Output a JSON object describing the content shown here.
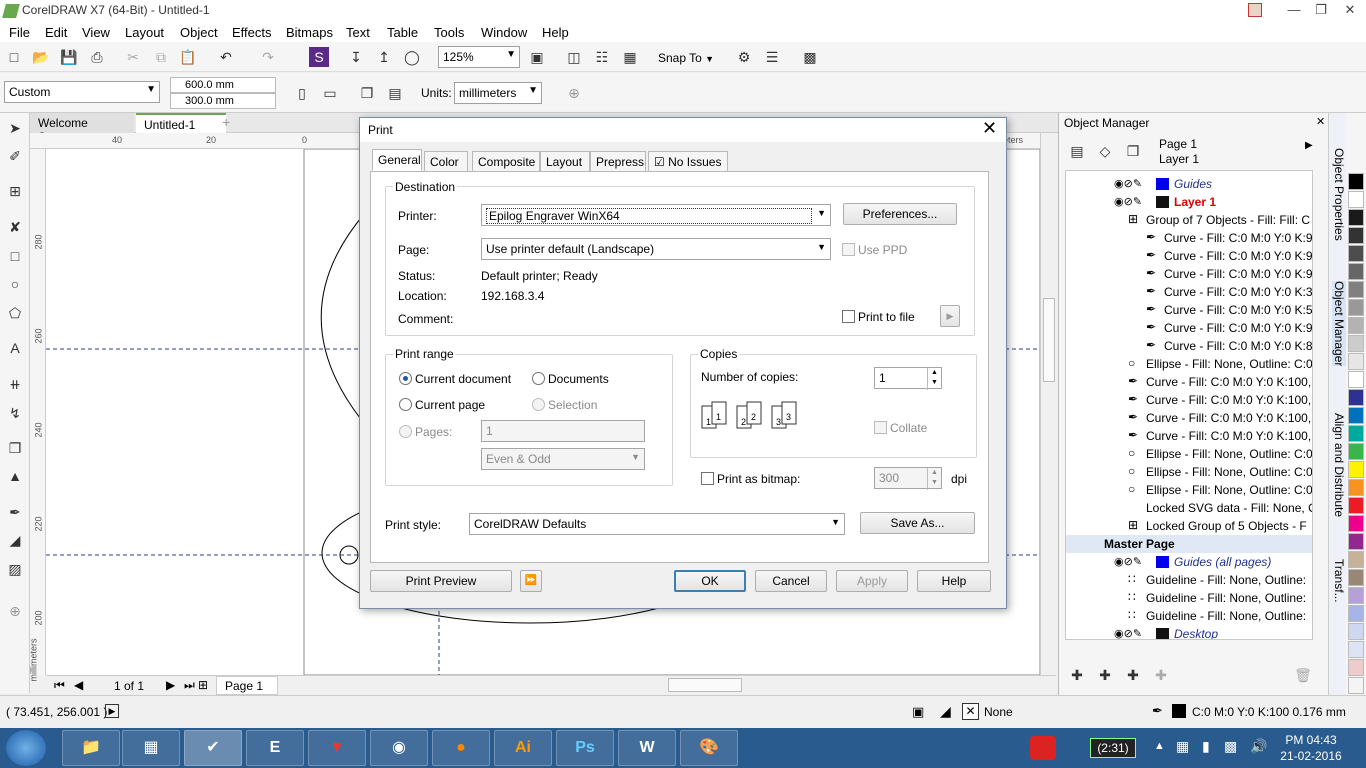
{
  "window": {
    "title": "CorelDRAW X7 (64-Bit) - Untitled-1"
  },
  "menu": [
    "File",
    "Edit",
    "View",
    "Layout",
    "Object",
    "Effects",
    "Bitmaps",
    "Text",
    "Table",
    "Tools",
    "Window",
    "Help"
  ],
  "toolbar": {
    "zoom": "125%",
    "snap_to": "Snap To"
  },
  "propbar": {
    "page_preset": "Custom",
    "width": "600.0 mm",
    "height": "300.0 mm",
    "units_label": "Units:",
    "units": "millimeters"
  },
  "doc_tabs": [
    "Welcome Screen",
    "Untitled-1"
  ],
  "ruler": {
    "top": [
      "40",
      "20",
      "0"
    ],
    "left": [
      "280",
      "260",
      "240",
      "220",
      "200"
    ],
    "unit": "millimeters",
    "unit_right": "millimeters"
  },
  "page_nav": {
    "count": "1 of 1",
    "tab": "Page 1"
  },
  "object_manager": {
    "title": "Object Manager",
    "page": "Page 1",
    "layer": "Layer 1",
    "rows": [
      {
        "indent": 0,
        "text": "Guides",
        "style": "guides"
      },
      {
        "indent": 0,
        "text": "Layer 1",
        "style": "layer"
      },
      {
        "indent": 1,
        "text": "Group of 7 Objects - Fill: Fill: C"
      },
      {
        "indent": 2,
        "text": "Curve - Fill: C:0 M:0 Y:0 K:9"
      },
      {
        "indent": 2,
        "text": "Curve - Fill: C:0 M:0 Y:0 K:9"
      },
      {
        "indent": 2,
        "text": "Curve - Fill: C:0 M:0 Y:0 K:9"
      },
      {
        "indent": 2,
        "text": "Curve - Fill: C:0 M:0 Y:0 K:3"
      },
      {
        "indent": 2,
        "text": "Curve - Fill: C:0 M:0 Y:0 K:5"
      },
      {
        "indent": 2,
        "text": "Curve - Fill: C:0 M:0 Y:0 K:9"
      },
      {
        "indent": 2,
        "text": "Curve - Fill: C:0 M:0 Y:0 K:8"
      },
      {
        "indent": 1,
        "text": "Ellipse - Fill: None, Outline: C:0"
      },
      {
        "indent": 1,
        "text": "Curve - Fill: C:0 M:0 Y:0 K:100,"
      },
      {
        "indent": 1,
        "text": "Curve - Fill: C:0 M:0 Y:0 K:100,"
      },
      {
        "indent": 1,
        "text": "Curve - Fill: C:0 M:0 Y:0 K:100,"
      },
      {
        "indent": 1,
        "text": "Curve - Fill: C:0 M:0 Y:0 K:100,"
      },
      {
        "indent": 1,
        "text": "Ellipse - Fill: None, Outline: C:0"
      },
      {
        "indent": 1,
        "text": "Ellipse - Fill: None, Outline: C:0"
      },
      {
        "indent": 1,
        "text": "Ellipse - Fill: None, Outline: C:0"
      },
      {
        "indent": 1,
        "text": "Locked SVG data - Fill: None, Out"
      },
      {
        "indent": 1,
        "text": "Locked Group of 5 Objects - F"
      },
      {
        "indent": 0,
        "text": "Master Page",
        "style": "master"
      },
      {
        "indent": 0,
        "text": "Guides (all pages)",
        "style": "guides-all"
      },
      {
        "indent": 1,
        "text": "Guideline - Fill: None, Outline:"
      },
      {
        "indent": 1,
        "text": "Guideline - Fill: None, Outline:"
      },
      {
        "indent": 1,
        "text": "Guideline - Fill: None, Outline:"
      },
      {
        "indent": 0,
        "text": "Desktop",
        "style": "desktop"
      }
    ]
  },
  "dockers": [
    "Object Properties",
    "Object Manager",
    "Align and Distribute",
    "Transf..."
  ],
  "palette": [
    "#000000",
    "#ffffff",
    "#1a1a1a",
    "#333333",
    "#4d4d4d",
    "#666666",
    "#808080",
    "#999999",
    "#b3b3b3",
    "#cccccc",
    "#e6e6e6",
    "#ffffff",
    "#2e3192",
    "#0071bc",
    "#00a99d",
    "#39b54a",
    "#fff200",
    "#f7941d",
    "#ed1c24",
    "#ec008c",
    "#92278f",
    "#c7b299",
    "#998675",
    "#b5a0d8",
    "#a7b4e8",
    "#cfd7f0",
    "#dfe3f6",
    "#ecc",
    "#f4f4f4"
  ],
  "status": {
    "coords": "( 73.451, 256.001 )",
    "fill": "None",
    "outline": "C:0 M:0 Y:0 K:100  0.176 mm"
  },
  "taskbar": {
    "apps": [
      "",
      "",
      "",
      "",
      "E",
      "",
      "",
      "",
      "Ai",
      "Ps",
      "W",
      ""
    ],
    "time": "PM 04:43",
    "date": "21-02-2016",
    "battery": "(2:31)"
  },
  "dialog": {
    "title": "Print",
    "tabs": [
      "General",
      "Color",
      "Composite",
      "Layout",
      "Prepress",
      "No Issues"
    ],
    "destination": {
      "label": "Destination",
      "printer_label": "Printer:",
      "printer": "Epilog Engraver WinX64",
      "preferences": "Preferences...",
      "page_label": "Page:",
      "page": "Use printer default (Landscape)",
      "use_ppd": "Use PPD",
      "status_label": "Status:",
      "status": "Default printer; Ready",
      "location_label": "Location:",
      "location": "192.168.3.4",
      "comment_label": "Comment:",
      "print_to_file": "Print to file"
    },
    "print_range": {
      "label": "Print range",
      "current_document": "Current document",
      "documents": "Documents",
      "current_page": "Current page",
      "selection": "Selection",
      "pages_label": "Pages:",
      "pages": "1",
      "even_odd": "Even & Odd"
    },
    "copies": {
      "label": "Copies",
      "number_label": "Number of copies:",
      "number": "1",
      "collate": "Collate",
      "print_as_bitmap": "Print as bitmap:",
      "dpi_value": "300",
      "dpi": "dpi"
    },
    "print_style_label": "Print style:",
    "print_style": "CorelDRAW Defaults",
    "save_as": "Save As...",
    "buttons": {
      "preview": "Print Preview",
      "ok": "OK",
      "cancel": "Cancel",
      "apply": "Apply",
      "help": "Help"
    }
  }
}
